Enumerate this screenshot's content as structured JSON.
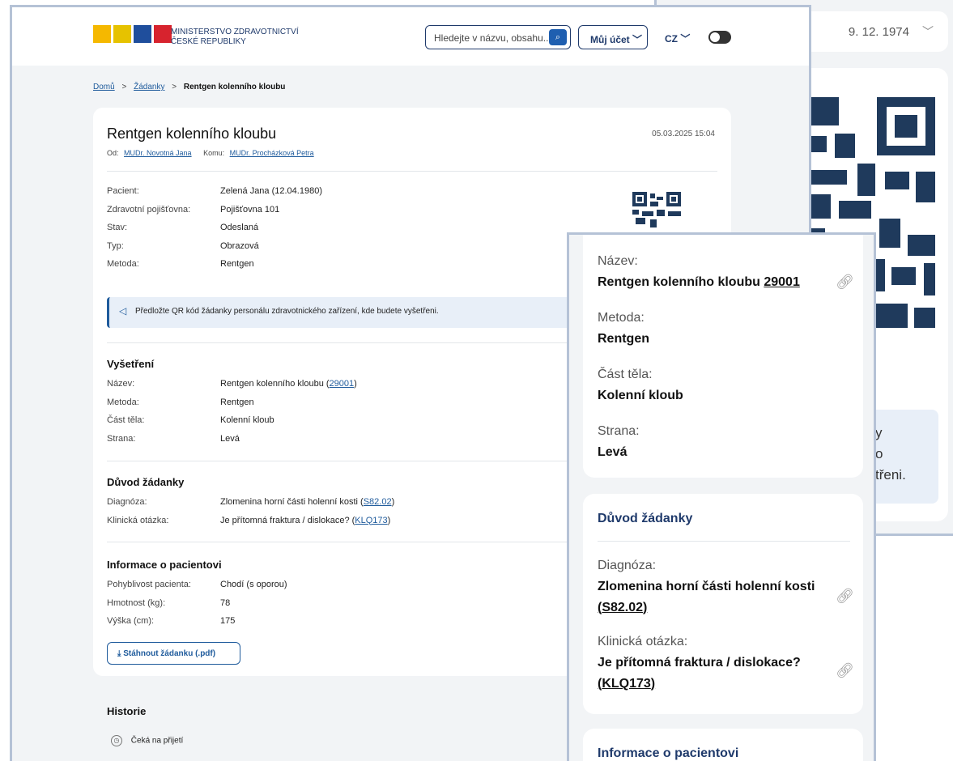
{
  "back": {
    "date": "9. 12. 1974",
    "info_lines": [
      "y",
      "o",
      "třeni."
    ]
  },
  "header": {
    "ministry_line1": "MINISTERSTVO ZDRAVOTNICTVÍ",
    "ministry_line2": "ČESKÉ REPUBLIKY",
    "search_placeholder": "Hledejte v názvu, obsahu...",
    "account_label": "Můj účet",
    "language": "CZ",
    "logo_colors": [
      "#f5b800",
      "#e6c200",
      "#1f4e9c",
      "#d7232e"
    ]
  },
  "breadcrumb": {
    "home": "Domů",
    "sep": ">",
    "requests": "Žádanky",
    "current": "Rentgen kolenního kloubu"
  },
  "request": {
    "title": "Rentgen kolenního kloubu",
    "timestamp": "05.03.2025 15:04",
    "from_label": "Od:",
    "from": "MUDr. Novotná Jana",
    "to_label": "Komu:",
    "to": "MUDr. Procházková Petra",
    "fields": [
      {
        "k": "Pacient:",
        "v": "Zelená Jana (12.04.1980)"
      },
      {
        "k": "Zdravotní pojišťovna:",
        "v": "Pojišťovna 101"
      },
      {
        "k": "Stav:",
        "v": "Odeslaná"
      },
      {
        "k": "Typ:",
        "v": "Obrazová"
      },
      {
        "k": "Metoda:",
        "v": "Rentgen"
      }
    ],
    "notice": "Předložte QR kód žádanky personálu zdravotnického zařízení, kde budete vyšetřeni.",
    "exam_heading": "Vyšetření",
    "exam": [
      {
        "k": "Název:",
        "v": "Rentgen kolenního kloubu (",
        "code": "29001",
        "after": ")"
      },
      {
        "k": "Metoda:",
        "v": "Rentgen"
      },
      {
        "k": "Část těla:",
        "v": "Kolenní kloub"
      },
      {
        "k": "Strana:",
        "v": "Levá"
      }
    ],
    "reason_heading": "Důvod žádanky",
    "reason": [
      {
        "k": "Diagnóza:",
        "v": "Zlomenina horní části holenní kosti (",
        "code": "S82.02",
        "after": ")"
      },
      {
        "k": "Klinická otázka:",
        "v": "Je přítomná fraktura / dislokace? (",
        "code": "KLQ173",
        "after": ")"
      }
    ],
    "patient_heading": "Informace o pacientovi",
    "patient": [
      {
        "k": "Pohyblivost pacienta:",
        "v": "Chodí (s oporou)"
      },
      {
        "k": "Hmotnost (kg):",
        "v": "78"
      },
      {
        "k": "Výška (cm):",
        "v": "175"
      }
    ],
    "download_label": "Stáhnout žádanku (.pdf)"
  },
  "history": {
    "heading": "Historie",
    "items": [
      "Čeká na přijetí"
    ]
  },
  "mobile": {
    "name_label": "Název:",
    "name_value": "Rentgen kolenního kloubu",
    "name_code": "29001",
    "method_label": "Metoda:",
    "method_value": "Rentgen",
    "body_label": "Část těla:",
    "body_value": "Kolenní kloub",
    "side_label": "Strana:",
    "side_value": "Levá",
    "reason_heading": "Důvod žádanky",
    "diag_label": "Diagnóza:",
    "diag_value": "Zlomenina horní části holenní kosti",
    "diag_code": "S82.02",
    "q_label": "Klinická otázka:",
    "q_value": "Je přítomná fraktura / dislokace?",
    "q_code": "KLQ173",
    "patient_heading": "Informace o pacientovi"
  }
}
